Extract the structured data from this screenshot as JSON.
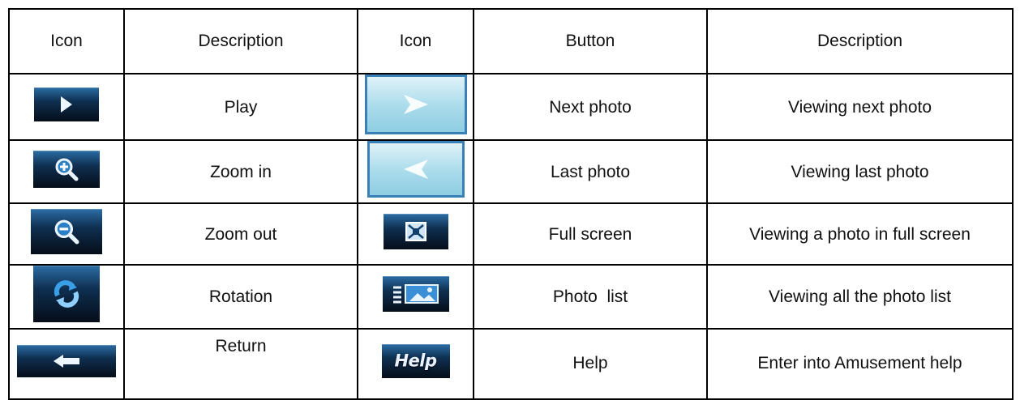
{
  "headers": {
    "icon_1": "Icon",
    "description_1": "Description",
    "icon_2": "Icon",
    "button": "Button",
    "description_2": "Description"
  },
  "rows": [
    {
      "left_icon": "play-icon",
      "left_label": "Play",
      "right_icon": "next-photo-icon",
      "button": "Next photo",
      "description": "Viewing next photo"
    },
    {
      "left_icon": "zoom-in-icon",
      "left_label": "Zoom in",
      "right_icon": "last-photo-icon",
      "button": "Last photo",
      "description": "Viewing last photo"
    },
    {
      "left_icon": "zoom-out-icon",
      "left_label": "Zoom out",
      "right_icon": "full-screen-icon",
      "button": "Full screen",
      "description": "Viewing a photo in full screen"
    },
    {
      "left_icon": "rotation-icon",
      "left_label": "Rotation",
      "right_icon": "photo-list-icon",
      "button": "Photo  list",
      "description": "Viewing all the photo list"
    },
    {
      "left_icon": "return-icon",
      "left_label": "Return",
      "right_icon": "help-icon",
      "button": "Help",
      "description": "Enter into Amusement help",
      "help_icon_text": "Help"
    }
  ],
  "colors": {
    "tile_dark": "#0f3052",
    "panel_light": "#a9dbeb",
    "panel_border": "#3a7fb6"
  }
}
